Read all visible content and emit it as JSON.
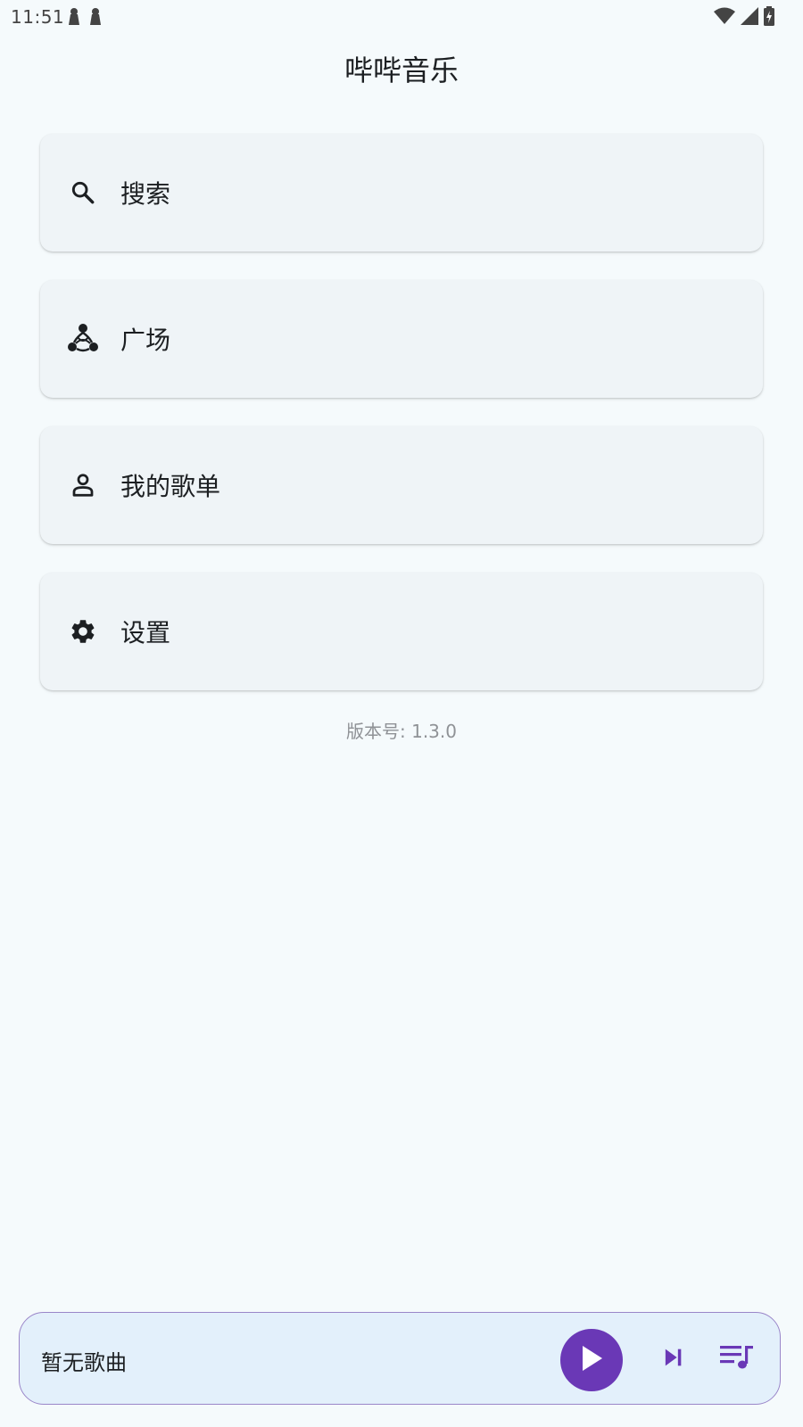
{
  "status_bar": {
    "time": "11:51",
    "icons": [
      "notification-icon",
      "notification-icon",
      "wifi-icon",
      "signal-icon",
      "battery-charging-icon"
    ]
  },
  "app": {
    "title": "哔哔音乐"
  },
  "menu": {
    "items": [
      {
        "label": "搜索",
        "icon": "search-icon"
      },
      {
        "label": "广场",
        "icon": "community-icon"
      },
      {
        "label": "我的歌单",
        "icon": "person-icon"
      },
      {
        "label": "设置",
        "icon": "gear-icon"
      }
    ]
  },
  "version": {
    "text": "版本号: 1.3.0"
  },
  "player": {
    "song_title": "暂无歌曲",
    "accent_color": "#6a38b6",
    "icons": [
      "play-icon",
      "skip-next-icon",
      "queue-music-icon"
    ]
  }
}
